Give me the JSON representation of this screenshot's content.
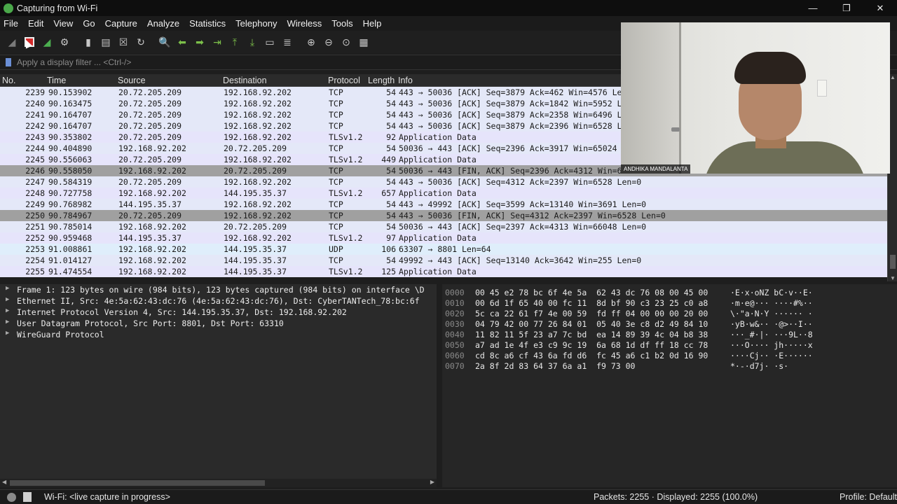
{
  "window": {
    "title": "Capturing from Wi-Fi"
  },
  "menu": [
    "File",
    "Edit",
    "View",
    "Go",
    "Capture",
    "Analyze",
    "Statistics",
    "Telephony",
    "Wireless",
    "Tools",
    "Help"
  ],
  "filter": {
    "placeholder": "Apply a display filter ... <Ctrl-/>"
  },
  "columns": {
    "no": "No.",
    "time": "Time",
    "source": "Source",
    "destination": "Destination",
    "protocol": "Protocol",
    "length": "Length",
    "info": "Info"
  },
  "packets": [
    {
      "no": "2239",
      "time": "90.153902",
      "src": "20.72.205.209",
      "dst": "192.168.92.202",
      "proto": "TCP",
      "len": "54",
      "info": "443 → 50036 [ACK] Seq=3879 Ack=462 Win=4576 Len=0"
    },
    {
      "no": "2240",
      "time": "90.163475",
      "src": "20.72.205.209",
      "dst": "192.168.92.202",
      "proto": "TCP",
      "len": "54",
      "info": "443 → 50036 [ACK] Seq=3879 Ack=1842 Win=5952 Len=0"
    },
    {
      "no": "2241",
      "time": "90.164707",
      "src": "20.72.205.209",
      "dst": "192.168.92.202",
      "proto": "TCP",
      "len": "54",
      "info": "443 → 50036 [ACK] Seq=3879 Ack=2358 Win=6496 Len=0"
    },
    {
      "no": "2242",
      "time": "90.164707",
      "src": "20.72.205.209",
      "dst": "192.168.92.202",
      "proto": "TCP",
      "len": "54",
      "info": "443 → 50036 [ACK] Seq=3879 Ack=2396 Win=6528 Len=0"
    },
    {
      "no": "2243",
      "time": "90.353802",
      "src": "20.72.205.209",
      "dst": "192.168.92.202",
      "proto": "TLSv1.2",
      "len": "92",
      "info": "Application Data"
    },
    {
      "no": "2244",
      "time": "90.404890",
      "src": "192.168.92.202",
      "dst": "20.72.205.209",
      "proto": "TCP",
      "len": "54",
      "info": "50036 → 443 [ACK] Seq=2396 Ack=3917 Win=65024 Len=0"
    },
    {
      "no": "2245",
      "time": "90.556063",
      "src": "20.72.205.209",
      "dst": "192.168.92.202",
      "proto": "TLSv1.2",
      "len": "449",
      "info": "Application Data"
    },
    {
      "no": "2246",
      "time": "90.558050",
      "src": "192.168.92.202",
      "dst": "20.72.205.209",
      "proto": "TCP",
      "len": "54",
      "info": "50036 → 443 [FIN, ACK] Seq=2396 Ack=4312 Win=65024 Len=0"
    },
    {
      "no": "2247",
      "time": "90.584319",
      "src": "20.72.205.209",
      "dst": "192.168.92.202",
      "proto": "TCP",
      "len": "54",
      "info": "443 → 50036 [ACK] Seq=4312 Ack=2397 Win=6528 Len=0"
    },
    {
      "no": "2248",
      "time": "90.727758",
      "src": "192.168.92.202",
      "dst": "144.195.35.37",
      "proto": "TLSv1.2",
      "len": "657",
      "info": "Application Data"
    },
    {
      "no": "2249",
      "time": "90.768982",
      "src": "144.195.35.37",
      "dst": "192.168.92.202",
      "proto": "TCP",
      "len": "54",
      "info": "443 → 49992 [ACK] Seq=3599 Ack=13140 Win=3691 Len=0"
    },
    {
      "no": "2250",
      "time": "90.784967",
      "src": "20.72.205.209",
      "dst": "192.168.92.202",
      "proto": "TCP",
      "len": "54",
      "info": "443 → 50036 [FIN, ACK] Seq=4312 Ack=2397 Win=6528 Len=0"
    },
    {
      "no": "2251",
      "time": "90.785014",
      "src": "192.168.92.202",
      "dst": "20.72.205.209",
      "proto": "TCP",
      "len": "54",
      "info": "50036 → 443 [ACK] Seq=2397 Ack=4313 Win=66048 Len=0"
    },
    {
      "no": "2252",
      "time": "90.959468",
      "src": "144.195.35.37",
      "dst": "192.168.92.202",
      "proto": "TLSv1.2",
      "len": "97",
      "info": "Application Data"
    },
    {
      "no": "2253",
      "time": "91.008861",
      "src": "192.168.92.202",
      "dst": "144.195.35.37",
      "proto": "UDP",
      "len": "106",
      "info": "63307 → 8801 Len=64"
    },
    {
      "no": "2254",
      "time": "91.014127",
      "src": "192.168.92.202",
      "dst": "144.195.35.37",
      "proto": "TCP",
      "len": "54",
      "info": "49992 → 443 [ACK] Seq=13140 Ack=3642 Win=255 Len=0"
    },
    {
      "no": "2255",
      "time": "91.474554",
      "src": "192.168.92.202",
      "dst": "144.195.35.37",
      "proto": "TLSv1.2",
      "len": "125",
      "info": "Application Data"
    }
  ],
  "details": [
    "Frame 1: 123 bytes on wire (984 bits), 123 bytes captured (984 bits) on interface \\D",
    "Ethernet II, Src: 4e:5a:62:43:dc:76 (4e:5a:62:43:dc:76), Dst: CyberTANTech_78:bc:6f",
    "Internet Protocol Version 4, Src: 144.195.35.37, Dst: 192.168.92.202",
    "User Datagram Protocol, Src Port: 8801, Dst Port: 63310",
    "WireGuard Protocol"
  ],
  "hex": [
    {
      "off": "0000",
      "bytes": "00 45 e2 78 bc 6f 4e 5a  62 43 dc 76 08 00 45 00",
      "ascii": "·E·x·oNZ bC·v··E·"
    },
    {
      "off": "0010",
      "bytes": "00 6d 1f 65 40 00 fc 11  8d bf 90 c3 23 25 c0 a8",
      "ascii": "·m·e@··· ····#%··"
    },
    {
      "off": "0020",
      "bytes": "5c ca 22 61 f7 4e 00 59  fd ff 04 00 00 00 20 00",
      "ascii": "\\·\"a·N·Y ······ ·"
    },
    {
      "off": "0030",
      "bytes": "04 79 42 00 77 26 84 01  05 40 3e c8 d2 49 84 10",
      "ascii": "·yB·w&·· ·@>··I··"
    },
    {
      "off": "0040",
      "bytes": "11 82 11 5f 23 a7 7c bd  ea 14 89 39 4c 04 b8 38",
      "ascii": "···_#·|· ···9L··8"
    },
    {
      "off": "0050",
      "bytes": "a7 ad 1e 4f e3 c9 9c 19  6a 68 1d df ff 18 cc 78",
      "ascii": "···O···· jh·····x"
    },
    {
      "off": "0060",
      "bytes": "cd 8c a6 cf 43 6a fd d6  fc 45 a6 c1 b2 0d 16 90",
      "ascii": "····Cj·· ·E······"
    },
    {
      "off": "0070",
      "bytes": "2a 8f 2d 83 64 37 6a a1  f9 73 00",
      "ascii": "*·-·d7j· ·s·"
    }
  ],
  "status": {
    "capture": "Wi-Fi: <live capture in progress>",
    "packets": "Packets: 2255 · Displayed: 2255 (100.0%)",
    "profile": "Profile: Default"
  },
  "webcam": {
    "label": "ANDHIKA MANDALANTA"
  },
  "colors": {
    "tcp_row": "#e4e8f8",
    "tls_row": "#e6e4fb",
    "udp_row": "#dfeefb",
    "fin_row": "#a0a0a0"
  }
}
